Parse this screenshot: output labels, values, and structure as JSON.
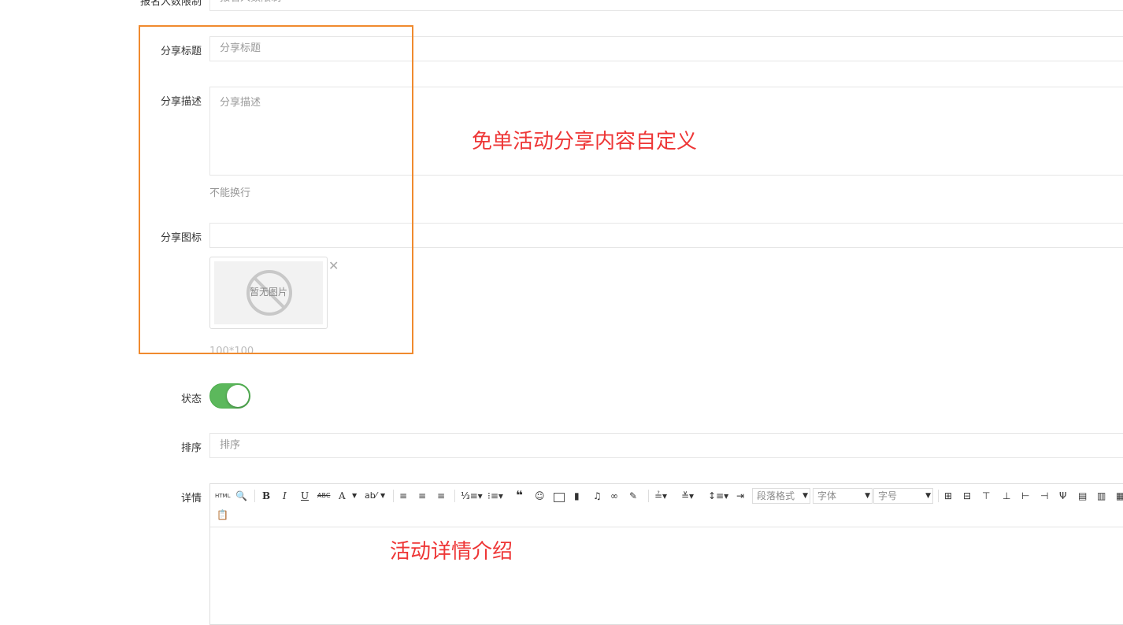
{
  "top_row": {
    "label": "报名人数限制",
    "placeholder": "报名人数限制"
  },
  "share_title": {
    "label": "分享标题",
    "placeholder": "分享标题"
  },
  "share_desc": {
    "label": "分享描述",
    "placeholder": "分享描述",
    "hint": "不能换行"
  },
  "share_icon": {
    "label": "分享图标",
    "no_image_text": "暂无图片",
    "close_glyph": "✕",
    "size_hint": "100*100"
  },
  "annotations": {
    "share_note": "免单活动分享内容自定义",
    "detail_note": "活动详情介绍"
  },
  "status": {
    "label": "状态",
    "enabled": true,
    "color": "#5cb85c"
  },
  "sort": {
    "label": "排序",
    "placeholder": "排序"
  },
  "detail": {
    "label": "详情",
    "toolbar": {
      "html_label": "HTML",
      "bold": "B",
      "italic": "I",
      "underline": "U",
      "strike": "ABC",
      "font_color": "A",
      "quote": "❝",
      "paragraph_format": "段落格式",
      "font_family": "字体",
      "font_size": "字号"
    }
  },
  "colors": {
    "accent_box": "#f08a2e",
    "annotation_text": "#ee3636",
    "toggle_on": "#5cb85c"
  }
}
